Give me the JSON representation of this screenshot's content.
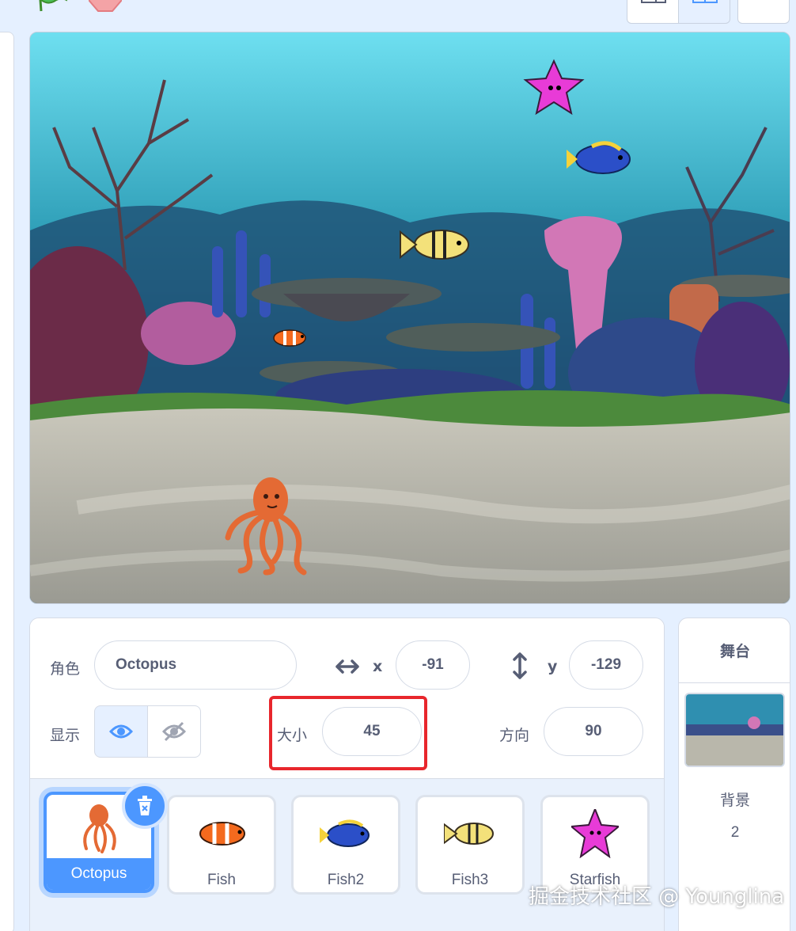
{
  "toolbar": {
    "green_flag_icon": "green-flag-icon",
    "stop_icon": "stop-icon",
    "layout_buttons": [
      "small-stage-icon",
      "large-stage-icon",
      "fullscreen-icon"
    ]
  },
  "sprite_info": {
    "sprite_label": "角色",
    "sprite_name": "Octopus",
    "x_label": "x",
    "x_value": "-91",
    "y_label": "y",
    "y_value": "-129",
    "show_label": "显示",
    "size_label": "大小",
    "size_value": "45",
    "direction_label": "方向",
    "direction_value": "90"
  },
  "sprites": [
    {
      "name": "Octopus",
      "selected": true
    },
    {
      "name": "Fish",
      "selected": false
    },
    {
      "name": "Fish2",
      "selected": false
    },
    {
      "name": "Fish3",
      "selected": false
    },
    {
      "name": "Starfish",
      "selected": false
    }
  ],
  "stage_panel": {
    "title": "舞台",
    "backdrops_label": "背景",
    "backdrops_count": "2"
  },
  "watermark": "掘金技术社区 @ Younglina",
  "colors": {
    "accent": "#4c97ff",
    "highlight_box": "#e8262c",
    "text": "#575e75"
  }
}
